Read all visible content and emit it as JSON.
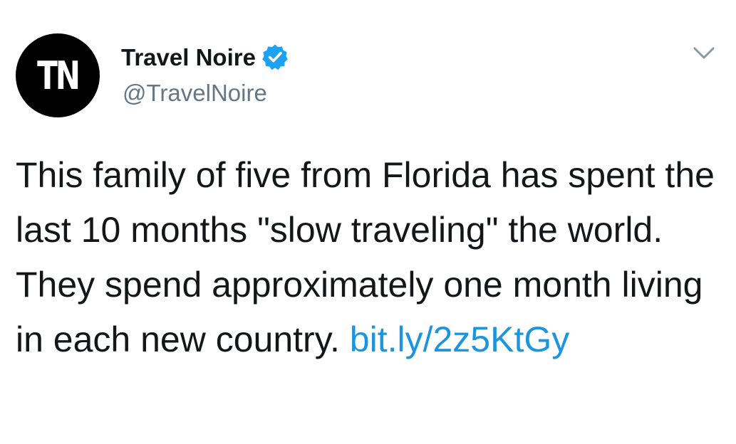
{
  "author": {
    "avatar_initials": "TN",
    "display_name": "Travel Noire",
    "handle": "@TravelNoire",
    "verified": true
  },
  "tweet": {
    "text": "This family of five from Florida has spent the last 10 months \"slow traveling\" the world. They spend approximately one month living in each new country.",
    "link": "bit.ly/2z5KtGy"
  },
  "icons": {
    "verified": "verified-badge-icon",
    "menu": "chevron-down-icon"
  },
  "colors": {
    "link": "#1b95e0",
    "verified_badge": "#1da1f2",
    "handle": "#657786",
    "text": "#14171a",
    "avatar_bg": "#000000"
  }
}
